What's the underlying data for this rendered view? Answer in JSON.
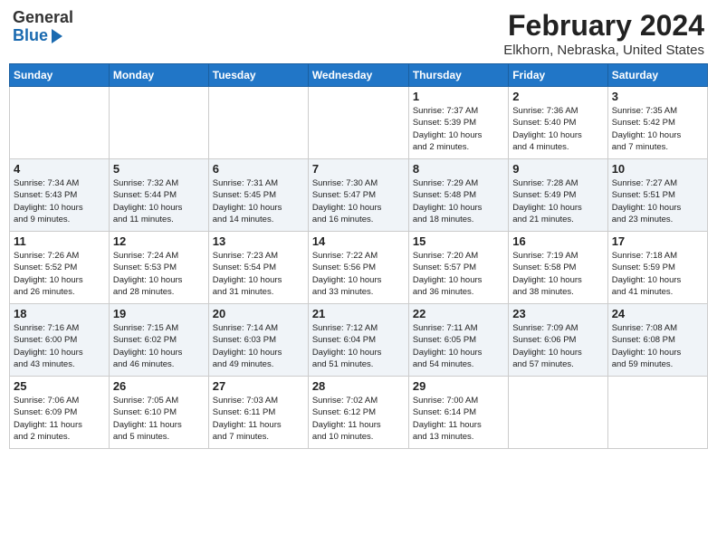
{
  "header": {
    "logo_line1": "General",
    "logo_line2": "Blue",
    "title": "February 2024",
    "subtitle": "Elkhorn, Nebraska, United States"
  },
  "weekdays": [
    "Sunday",
    "Monday",
    "Tuesday",
    "Wednesday",
    "Thursday",
    "Friday",
    "Saturday"
  ],
  "weeks": [
    [
      {
        "day": "",
        "info": ""
      },
      {
        "day": "",
        "info": ""
      },
      {
        "day": "",
        "info": ""
      },
      {
        "day": "",
        "info": ""
      },
      {
        "day": "1",
        "info": "Sunrise: 7:37 AM\nSunset: 5:39 PM\nDaylight: 10 hours\nand 2 minutes."
      },
      {
        "day": "2",
        "info": "Sunrise: 7:36 AM\nSunset: 5:40 PM\nDaylight: 10 hours\nand 4 minutes."
      },
      {
        "day": "3",
        "info": "Sunrise: 7:35 AM\nSunset: 5:42 PM\nDaylight: 10 hours\nand 7 minutes."
      }
    ],
    [
      {
        "day": "4",
        "info": "Sunrise: 7:34 AM\nSunset: 5:43 PM\nDaylight: 10 hours\nand 9 minutes."
      },
      {
        "day": "5",
        "info": "Sunrise: 7:32 AM\nSunset: 5:44 PM\nDaylight: 10 hours\nand 11 minutes."
      },
      {
        "day": "6",
        "info": "Sunrise: 7:31 AM\nSunset: 5:45 PM\nDaylight: 10 hours\nand 14 minutes."
      },
      {
        "day": "7",
        "info": "Sunrise: 7:30 AM\nSunset: 5:47 PM\nDaylight: 10 hours\nand 16 minutes."
      },
      {
        "day": "8",
        "info": "Sunrise: 7:29 AM\nSunset: 5:48 PM\nDaylight: 10 hours\nand 18 minutes."
      },
      {
        "day": "9",
        "info": "Sunrise: 7:28 AM\nSunset: 5:49 PM\nDaylight: 10 hours\nand 21 minutes."
      },
      {
        "day": "10",
        "info": "Sunrise: 7:27 AM\nSunset: 5:51 PM\nDaylight: 10 hours\nand 23 minutes."
      }
    ],
    [
      {
        "day": "11",
        "info": "Sunrise: 7:26 AM\nSunset: 5:52 PM\nDaylight: 10 hours\nand 26 minutes."
      },
      {
        "day": "12",
        "info": "Sunrise: 7:24 AM\nSunset: 5:53 PM\nDaylight: 10 hours\nand 28 minutes."
      },
      {
        "day": "13",
        "info": "Sunrise: 7:23 AM\nSunset: 5:54 PM\nDaylight: 10 hours\nand 31 minutes."
      },
      {
        "day": "14",
        "info": "Sunrise: 7:22 AM\nSunset: 5:56 PM\nDaylight: 10 hours\nand 33 minutes."
      },
      {
        "day": "15",
        "info": "Sunrise: 7:20 AM\nSunset: 5:57 PM\nDaylight: 10 hours\nand 36 minutes."
      },
      {
        "day": "16",
        "info": "Sunrise: 7:19 AM\nSunset: 5:58 PM\nDaylight: 10 hours\nand 38 minutes."
      },
      {
        "day": "17",
        "info": "Sunrise: 7:18 AM\nSunset: 5:59 PM\nDaylight: 10 hours\nand 41 minutes."
      }
    ],
    [
      {
        "day": "18",
        "info": "Sunrise: 7:16 AM\nSunset: 6:00 PM\nDaylight: 10 hours\nand 43 minutes."
      },
      {
        "day": "19",
        "info": "Sunrise: 7:15 AM\nSunset: 6:02 PM\nDaylight: 10 hours\nand 46 minutes."
      },
      {
        "day": "20",
        "info": "Sunrise: 7:14 AM\nSunset: 6:03 PM\nDaylight: 10 hours\nand 49 minutes."
      },
      {
        "day": "21",
        "info": "Sunrise: 7:12 AM\nSunset: 6:04 PM\nDaylight: 10 hours\nand 51 minutes."
      },
      {
        "day": "22",
        "info": "Sunrise: 7:11 AM\nSunset: 6:05 PM\nDaylight: 10 hours\nand 54 minutes."
      },
      {
        "day": "23",
        "info": "Sunrise: 7:09 AM\nSunset: 6:06 PM\nDaylight: 10 hours\nand 57 minutes."
      },
      {
        "day": "24",
        "info": "Sunrise: 7:08 AM\nSunset: 6:08 PM\nDaylight: 10 hours\nand 59 minutes."
      }
    ],
    [
      {
        "day": "25",
        "info": "Sunrise: 7:06 AM\nSunset: 6:09 PM\nDaylight: 11 hours\nand 2 minutes."
      },
      {
        "day": "26",
        "info": "Sunrise: 7:05 AM\nSunset: 6:10 PM\nDaylight: 11 hours\nand 5 minutes."
      },
      {
        "day": "27",
        "info": "Sunrise: 7:03 AM\nSunset: 6:11 PM\nDaylight: 11 hours\nand 7 minutes."
      },
      {
        "day": "28",
        "info": "Sunrise: 7:02 AM\nSunset: 6:12 PM\nDaylight: 11 hours\nand 10 minutes."
      },
      {
        "day": "29",
        "info": "Sunrise: 7:00 AM\nSunset: 6:14 PM\nDaylight: 11 hours\nand 13 minutes."
      },
      {
        "day": "",
        "info": ""
      },
      {
        "day": "",
        "info": ""
      }
    ]
  ]
}
